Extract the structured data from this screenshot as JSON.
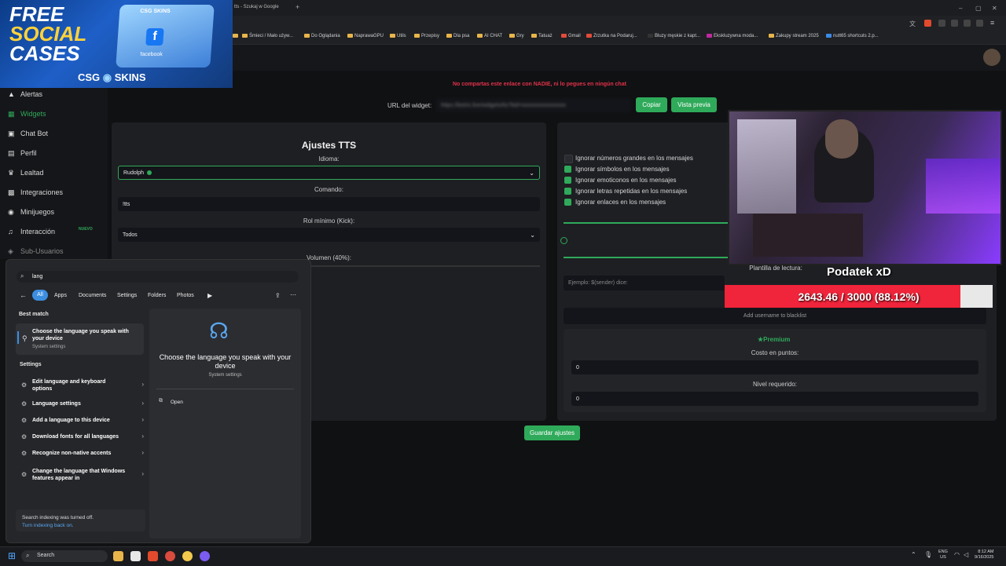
{
  "browser": {
    "tab_title": "tts - Szukaj w Google",
    "bookmarks": [
      "Śmieci / Mało używ...",
      "Do Oglądania",
      "NaprawaGPU",
      "Utils",
      "Przepisy",
      "Dla psa",
      "AI CHAT",
      "Gry",
      "Tatuaż",
      "Gmail",
      "Zrzutka na Podaruj...",
      "Bluzy męskie z kapt...",
      "Ekskluzywna moda...",
      "Zakupy stream 2025",
      "nutt65 shortcuts 2.p..."
    ]
  },
  "ad": {
    "line1": "FREE",
    "line2": "SOCIAL",
    "line3": "CASES",
    "brand_left": "CSG",
    "brand_right": "SKINS",
    "box_label": "CSG SKINS",
    "box_badge": "facebook"
  },
  "sidebar": {
    "items": [
      {
        "label": "Alertas",
        "icon": "warning-icon"
      },
      {
        "label": "Widgets",
        "icon": "grid-icon"
      },
      {
        "label": "Chat Bot",
        "icon": "robot-icon"
      },
      {
        "label": "Perfil",
        "icon": "id-card-icon"
      },
      {
        "label": "Lealtad",
        "icon": "trophy-icon"
      },
      {
        "label": "Integraciones",
        "icon": "plug-icon"
      },
      {
        "label": "Minijuegos",
        "icon": "gamepad-icon"
      },
      {
        "label": "Interacción",
        "icon": "music-icon"
      },
      {
        "label": "Sub-Usuarios",
        "icon": "users-icon"
      }
    ],
    "new_badge": "NUEVO"
  },
  "widget": {
    "warning": "No compartas este enlace con NADIE, ni lo pegues en ningún chat",
    "url_label": "URL del widget:",
    "url_value": "https://botrix.live/widgets/tts?bid=xxxxxxxxxxxxxxxx",
    "copy_button": "Copiar",
    "preview_button": "Vista previa"
  },
  "tts": {
    "title": "Ajustes TTS",
    "language_label": "Idioma:",
    "language_value": "Rudolph",
    "command_label": "Comando:",
    "command_value": "!tts",
    "role_label": "Rol mínimo (Kick):",
    "role_value": "Todos",
    "volume_label": "Volumen (40%):",
    "volume_pct": 40
  },
  "options": [
    {
      "label": "Ignorar números grandes en los mensajes",
      "checked": false
    },
    {
      "label": "Ignorar símbolos en los mensajes",
      "checked": true
    },
    {
      "label": "Ignorar emoticonos en los mensajes",
      "checked": true
    },
    {
      "label": "Ignorar letras repetidas en los mensajes",
      "checked": true
    },
    {
      "label": "Ignorar enlaces en los mensajes",
      "checked": true
    }
  ],
  "template": {
    "label": "Plantilla de lectura:",
    "placeholder": "Ejemplo: $(sender) dice:",
    "blacklist_placeholder": "Add username to blacklist"
  },
  "premium": {
    "title": "Premium",
    "cost_label": "Costo en puntos:",
    "cost_value": "0",
    "level_label": "Nivel requerido:",
    "level_value": "0"
  },
  "save_button": "Guardar ajustes",
  "overlay": {
    "goal_title": "Podatek xD",
    "goal_text": "2643.46 / 3000 (88.12%)",
    "goal_fraction": 0.8812
  },
  "search": {
    "query": "lang",
    "filters": [
      "All",
      "Apps",
      "Documents",
      "Settings",
      "Folders",
      "Photos"
    ],
    "best_match_header": "Best match",
    "best_match_title": "Choose the language you speak with your device",
    "best_match_sub": "System settings",
    "settings_header": "Settings",
    "settings_items": [
      "Edit language and keyboard options",
      "Language settings",
      "Add a language to this device",
      "Download fonts for all languages",
      "Recognize non-native accents",
      "Change the language that Windows features appear in"
    ],
    "preview_title": "Choose the language you speak with your device",
    "preview_sub": "System settings",
    "open_label": "Open",
    "index_note": "Search indexing was turned off.",
    "index_link": "Turn indexing back on."
  },
  "taskbar": {
    "search_label": "Search",
    "lang_top": "ENG",
    "lang_bottom": "US",
    "time": "8:12 AM",
    "date": "9/16/2025"
  },
  "colors": {
    "accent": "#2faa5a",
    "warning": "#e0314a",
    "goal_fill": "#f0243a"
  }
}
